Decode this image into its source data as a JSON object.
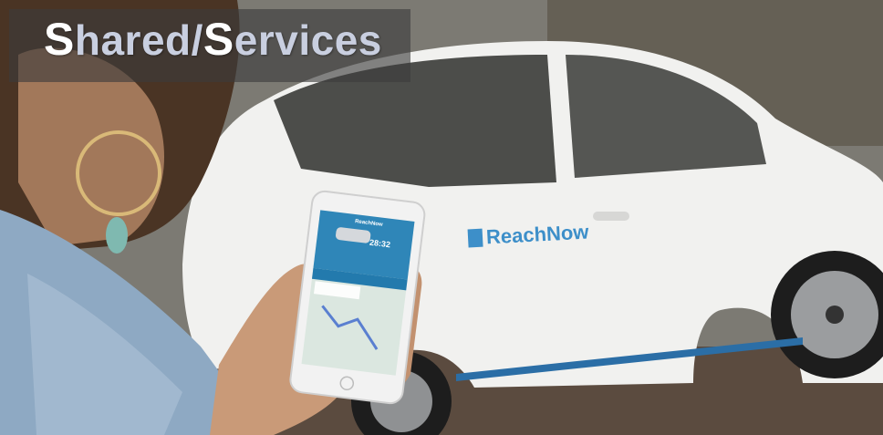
{
  "title": {
    "first_cap": "S",
    "first_rest": "hared/",
    "second_cap": "S",
    "second_rest": "ervices"
  },
  "car_brand_text": "ReachNow",
  "phone": {
    "app_title": "ReachNow",
    "time": "28:32"
  },
  "colors": {
    "title_text": "#c9cfe0",
    "title_caps": "#ffffff",
    "banner": "#3c3c3c",
    "brand_blue": "#3d8fc9",
    "car_white": "#f4f4f2"
  }
}
